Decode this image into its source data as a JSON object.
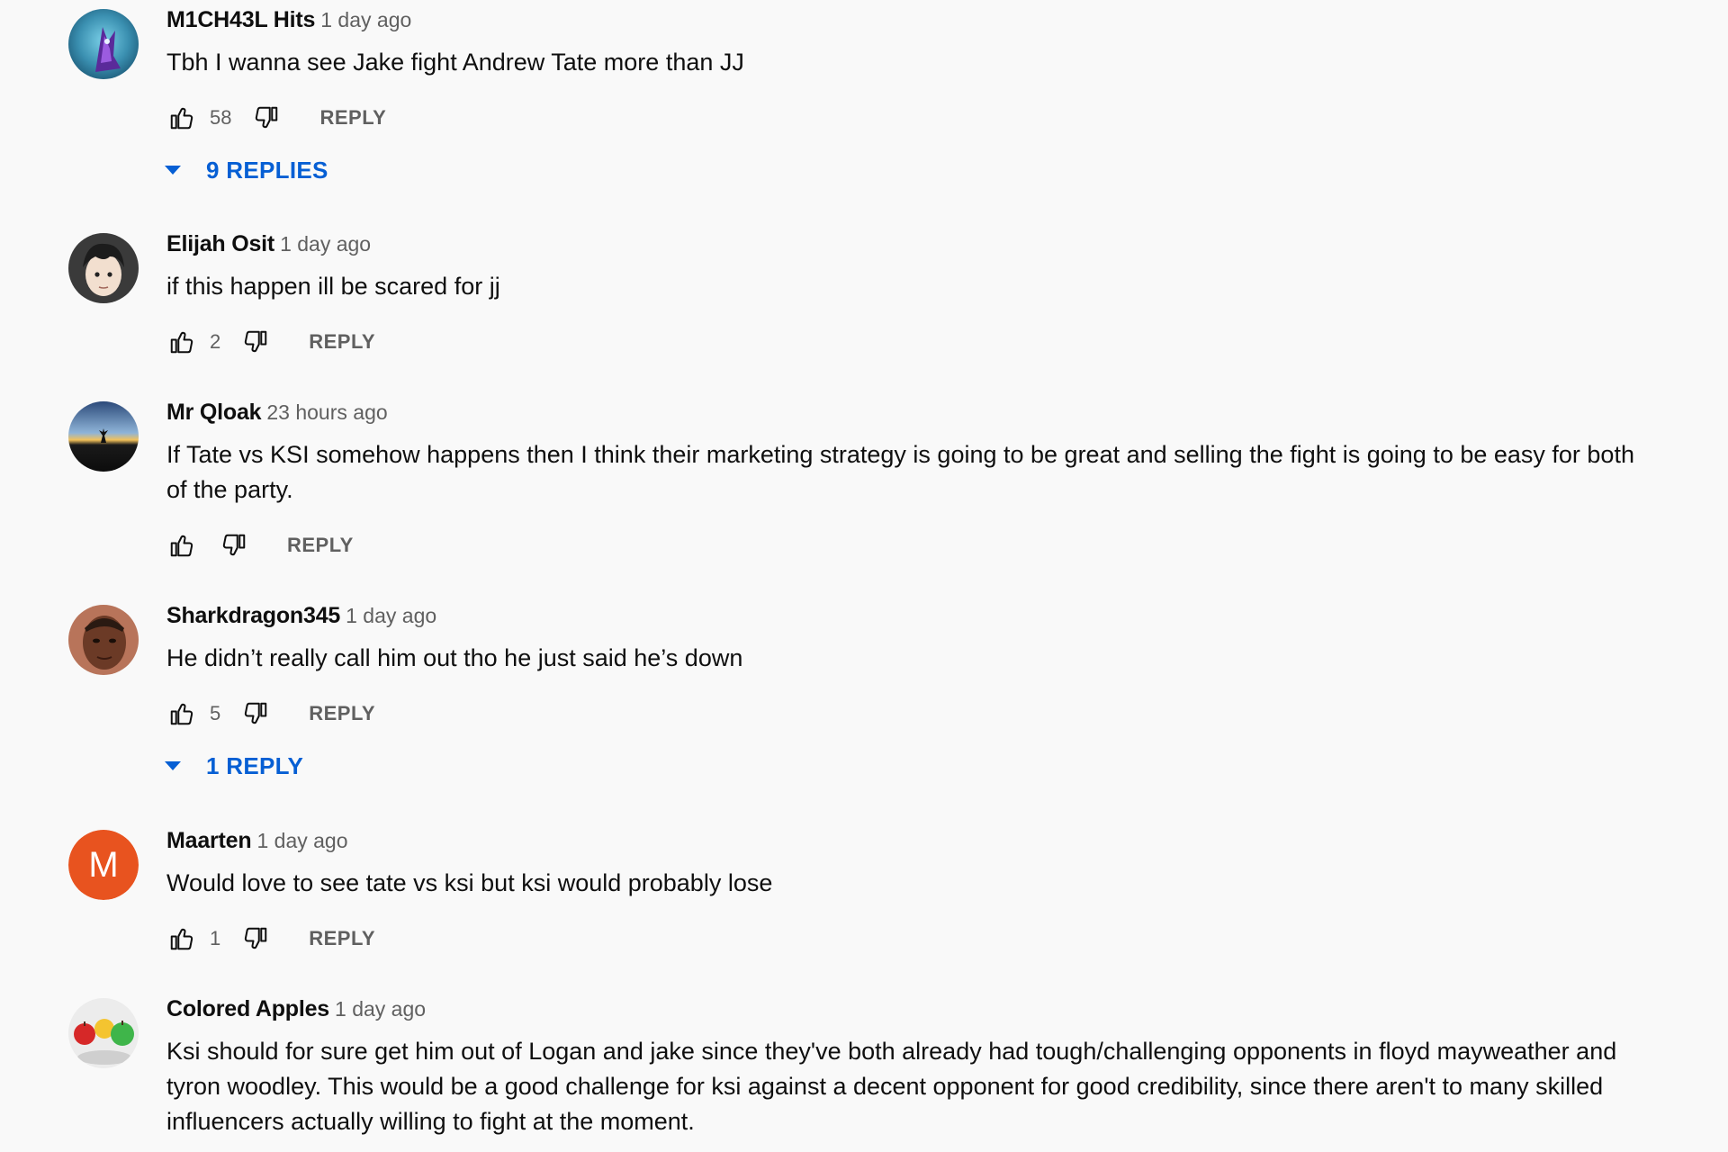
{
  "comments": [
    {
      "author": "M1CH43L Hits",
      "time": "1 day ago",
      "text": "Tbh I wanna see Jake fight Andrew Tate more than JJ",
      "likes": "58",
      "reply_label": "REPLY",
      "replies_label": "9 REPLIES",
      "avatar_icon": "purple-wolf-avatar"
    },
    {
      "author": "Elijah Osit",
      "time": "1 day ago",
      "text": "if this happen ill be scared for jj",
      "likes": "2",
      "reply_label": "REPLY",
      "avatar_icon": "cartoon-face-avatar"
    },
    {
      "author": "Mr Qloak",
      "time": "23 hours ago",
      "text": "If Tate vs KSI somehow happens then I think their marketing strategy is going to be great and selling the fight is going to be easy for both of the party.",
      "likes": "",
      "reply_label": "REPLY",
      "avatar_icon": "sunset-silhouette-avatar"
    },
    {
      "author": "Sharkdragon345",
      "time": "1 day ago",
      "text": "He didn’t really call him out tho he just said he’s down",
      "likes": "5",
      "reply_label": "REPLY",
      "replies_label": "1 REPLY",
      "avatar_icon": "man-face-avatar"
    },
    {
      "author": "Maarten",
      "time": "1 day ago",
      "text": "Would love to see tate vs ksi but ksi would probably lose",
      "likes": "1",
      "reply_label": "REPLY",
      "avatar_letter": "M",
      "avatar_color": "#e8531f"
    },
    {
      "author": "Colored Apples",
      "time": "1 day ago",
      "text": "Ksi should for sure get him out of Logan and jake since they've both already had tough/challenging opponents in floyd mayweather and tyron woodley. This would be a good challenge for ksi against a decent opponent for good credibility, since there aren't to many skilled influencers actually willing to fight at the moment.",
      "avatar_icon": "colored-apples-avatar"
    }
  ],
  "colors": {
    "background": "#f9f9f9",
    "link_blue": "#065fd4",
    "secondary_text": "#606060"
  }
}
